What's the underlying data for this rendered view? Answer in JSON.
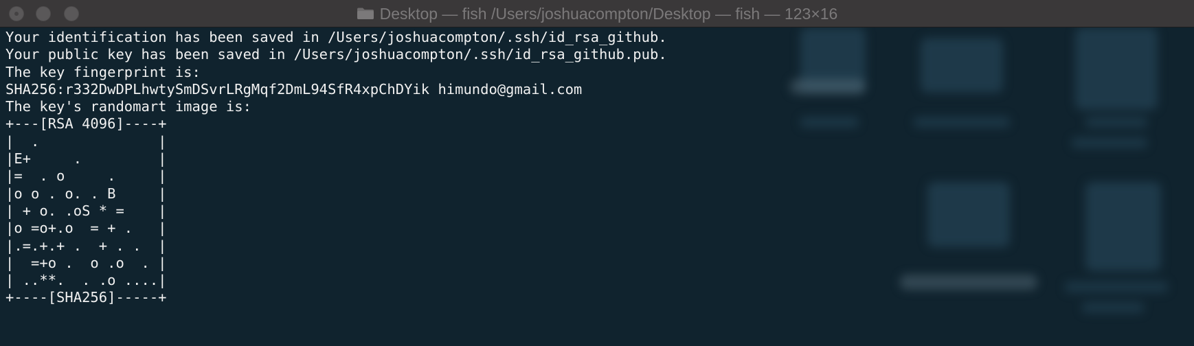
{
  "window": {
    "title": "Desktop — fish /Users/joshuacompton/Desktop — fish — 123×16",
    "title_icon": "folder-icon",
    "controls": [
      "close",
      "minimize",
      "maximize"
    ]
  },
  "terminal": {
    "lines": [
      "Your identification has been saved in /Users/joshuacompton/.ssh/id_rsa_github.",
      "Your public key has been saved in /Users/joshuacompton/.ssh/id_rsa_github.pub.",
      "The key fingerprint is:",
      "SHA256:r332DwDPLhwtySmDSvrLRgMqf2DmL94SfR4xpChDYik himundo@gmail.com",
      "The key's randomart image is:",
      "+---[RSA 4096]----+",
      "|  .              |",
      "|E+     .         |",
      "|=  . o     .     |",
      "|o o . o. . B     |",
      "| + o. .oS * =    |",
      "|o =o+.o  = + .   |",
      "|.=.+.+ .  + . .  |",
      "|  =+o .  o .o  . |",
      "| ..**.  . .o ....|",
      "+----[SHA256]-----+"
    ]
  },
  "colors": {
    "titlebar": "#3a3839",
    "title_text": "#7b797a",
    "terminal_bg": "#10232e",
    "terminal_text": "#f1f1f1"
  }
}
